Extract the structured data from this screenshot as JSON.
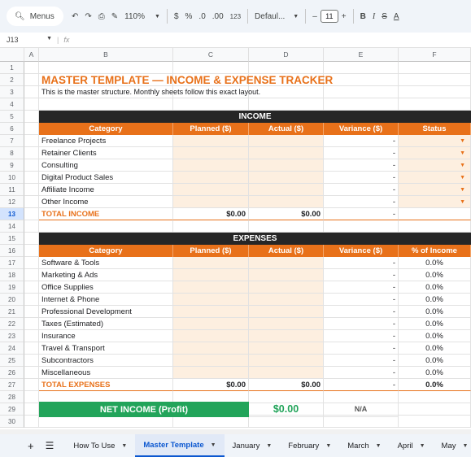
{
  "toolbar": {
    "menus": "Menus",
    "zoom": "110%",
    "currency": "$",
    "percent": "%",
    "dec_dec": ".0",
    "inc_dec": ".00",
    "format_123": "123",
    "font": "Defaul...",
    "font_size": "11"
  },
  "formula": {
    "cell_ref": "J13",
    "fx": "fx"
  },
  "columns": [
    "A",
    "B",
    "C",
    "D",
    "E",
    "F"
  ],
  "rows": [
    "1",
    "2",
    "3",
    "4",
    "5",
    "6",
    "7",
    "8",
    "9",
    "10",
    "11",
    "12",
    "13",
    "14",
    "15",
    "16",
    "17",
    "18",
    "19",
    "20",
    "21",
    "22",
    "23",
    "24",
    "25",
    "26",
    "27",
    "28",
    "29",
    "30"
  ],
  "sheet": {
    "title": "MASTER TEMPLATE — INCOME & EXPENSE TRACKER",
    "subtitle": "This is the master structure. Monthly sheets follow this exact layout.",
    "income_band": "INCOME",
    "income_headers": [
      "Category",
      "Planned ($)",
      "Actual ($)",
      "Variance ($)",
      "Status"
    ],
    "income_items": [
      "Freelance Projects",
      "Retainer Clients",
      "Consulting",
      "Digital Product Sales",
      "Affiliate Income",
      "Other Income"
    ],
    "total_income": {
      "label": "TOTAL INCOME",
      "planned": "$0.00",
      "actual": "$0.00",
      "variance": "-"
    },
    "expenses_band": "EXPENSES",
    "expense_headers": [
      "Category",
      "Planned ($)",
      "Actual ($)",
      "Variance ($)",
      "% of Income"
    ],
    "expense_items": [
      "Software & Tools",
      "Marketing & Ads",
      "Office Supplies",
      "Internet & Phone",
      "Professional Development",
      "Taxes (Estimated)",
      "Insurance",
      "Travel & Transport",
      "Subcontractors",
      "Miscellaneous"
    ],
    "expense_pct": "0.0%",
    "total_expenses": {
      "label": "TOTAL EXPENSES",
      "planned": "$0.00",
      "actual": "$0.00",
      "variance": "-",
      "pct": "0.0%"
    },
    "net": {
      "label": "NET INCOME (Profit)",
      "value": "$0.00",
      "na": "N/A"
    },
    "dash": "-"
  },
  "tabs": [
    "How To Use",
    "Master Template",
    "January",
    "February",
    "March",
    "April",
    "May"
  ],
  "colors": {
    "accent": "#e8711a",
    "band": "#262626",
    "green": "#22a45a",
    "peach": "#fdefe0"
  }
}
